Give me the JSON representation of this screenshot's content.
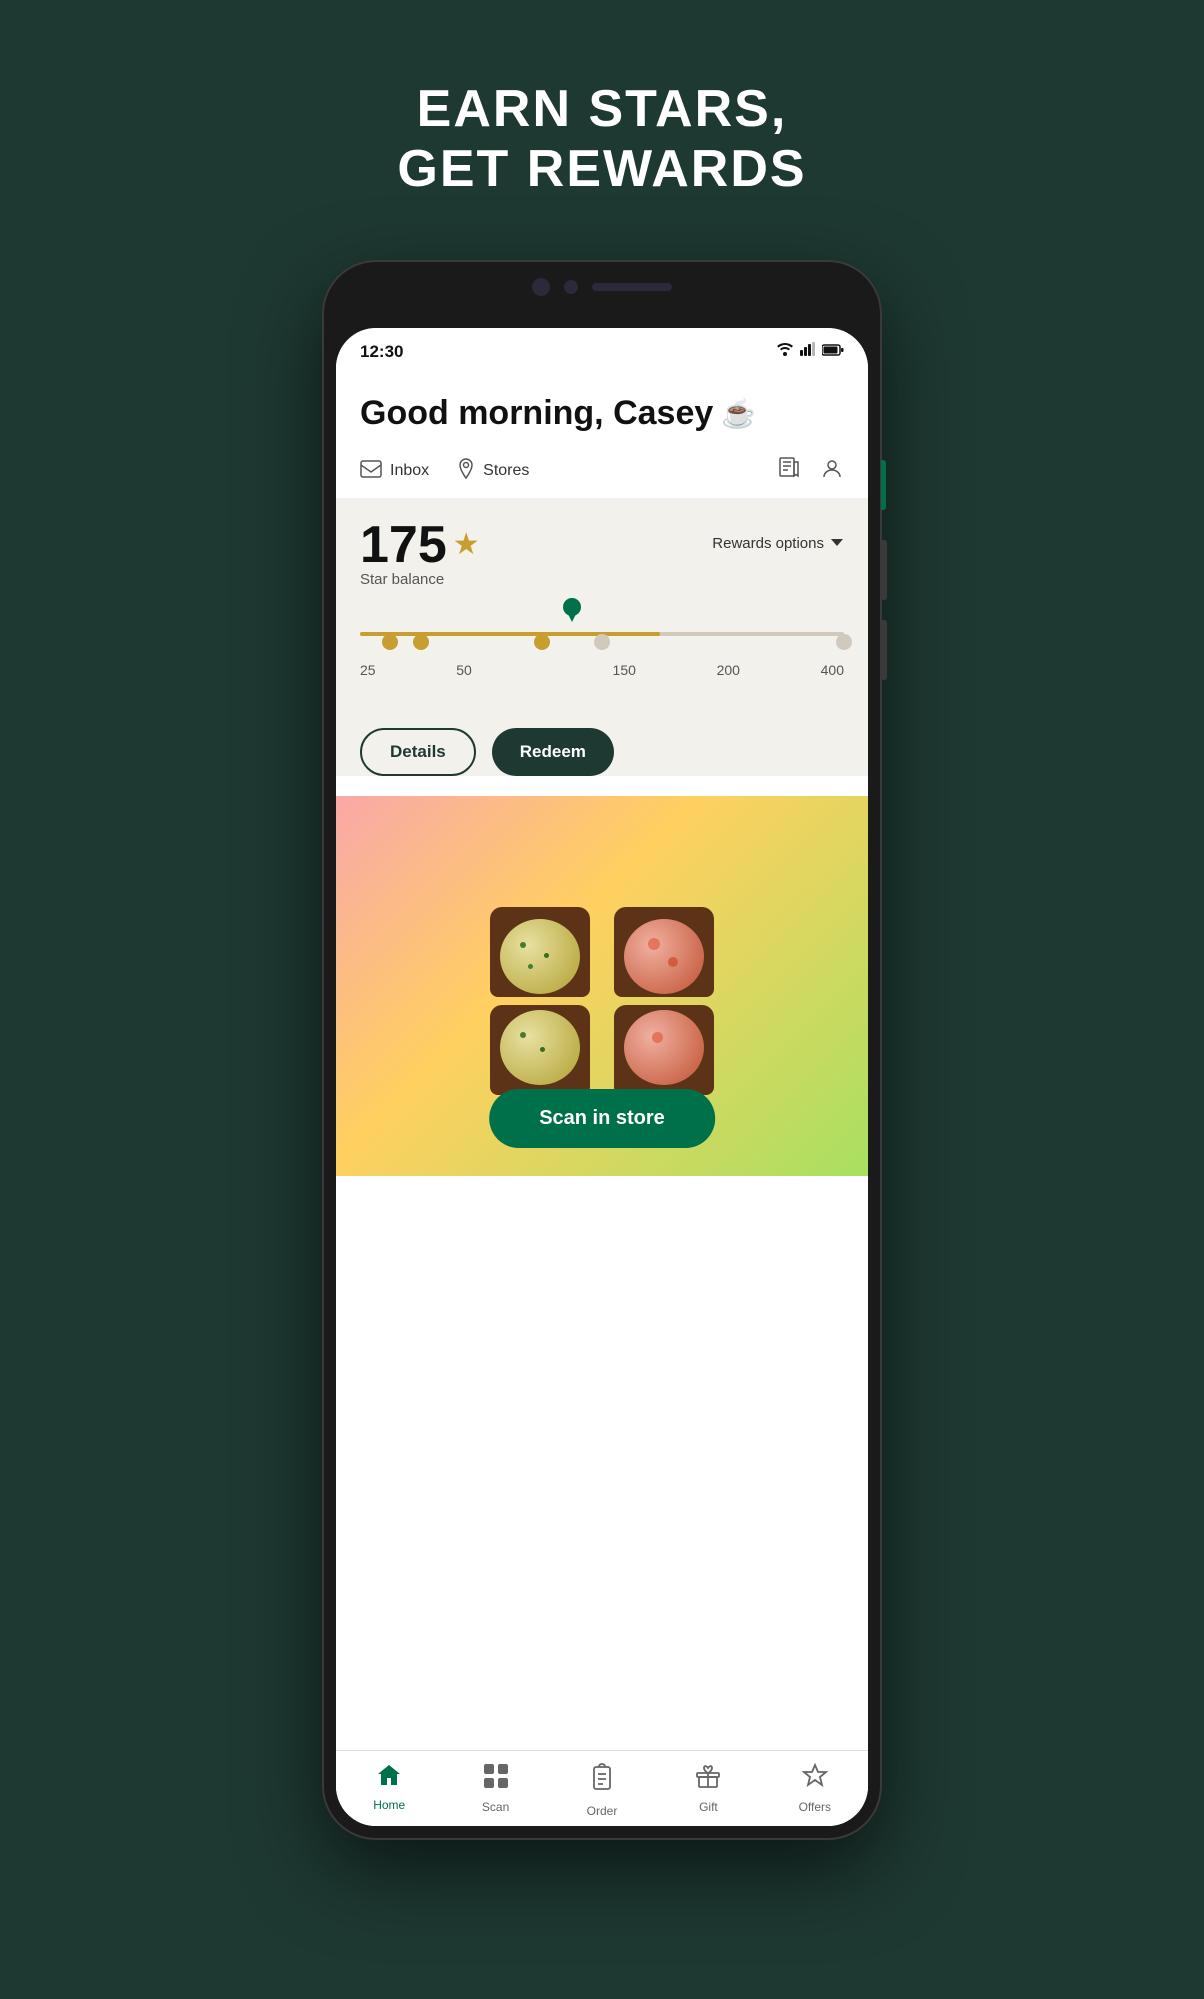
{
  "page": {
    "background_color": "#1e3932",
    "title": "EARN STARS,\nGET REWARDS"
  },
  "status_bar": {
    "time": "12:30",
    "wifi": "wifi",
    "signal": "signal",
    "battery": "battery"
  },
  "header": {
    "greeting": "Good morning, Casey",
    "coffee_emoji": "☕",
    "inbox_label": "Inbox",
    "stores_label": "Stores"
  },
  "rewards": {
    "star_count": "175",
    "star_balance_label": "Star balance",
    "rewards_options_label": "Rewards options",
    "progress_points": [
      25,
      50,
      150,
      200,
      400
    ],
    "current_stars": 175,
    "details_button": "Details",
    "redeem_button": "Redeem"
  },
  "scan_card": {
    "scan_in_store_label": "Scan in store"
  },
  "bottom_nav": {
    "tabs": [
      {
        "label": "Home",
        "icon": "home",
        "active": true
      },
      {
        "label": "Scan",
        "icon": "scan",
        "active": false
      },
      {
        "label": "Order",
        "icon": "order",
        "active": false
      },
      {
        "label": "Gift",
        "icon": "gift",
        "active": false
      },
      {
        "label": "Offers",
        "icon": "offers",
        "active": false
      }
    ]
  }
}
